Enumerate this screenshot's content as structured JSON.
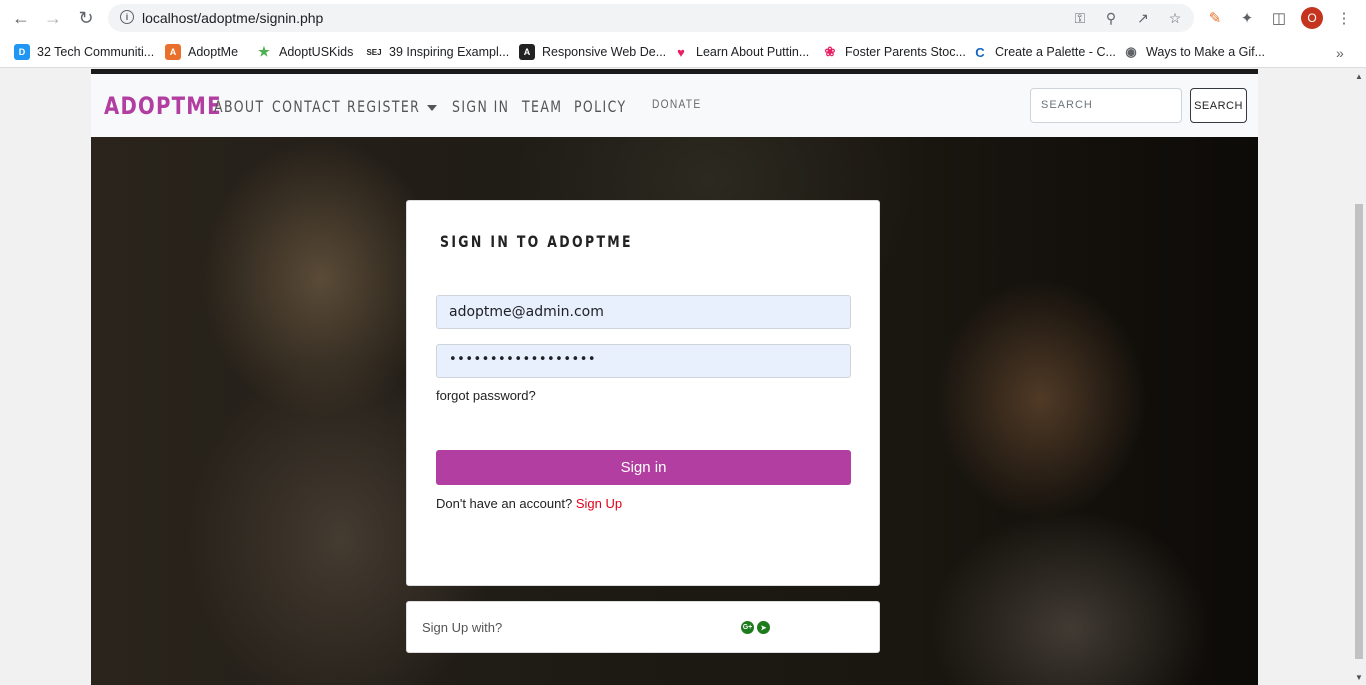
{
  "browser": {
    "url": "localhost/adoptme/signin.php",
    "avatar_letter": "O",
    "bookmarks": [
      {
        "label": "32 Tech Communiti...",
        "icon": "doc-icon",
        "color": "#2196f3"
      },
      {
        "label": "AdoptMe",
        "icon": "adoptme-icon",
        "color": "#e8702a"
      },
      {
        "label": "AdoptUSKids",
        "icon": "person-icon",
        "color": "#4caf50"
      },
      {
        "label": "39 Inspiring Exampl...",
        "icon": "sej-icon",
        "color": "#222222"
      },
      {
        "label": "Responsive Web De...",
        "icon": "responsive-icon",
        "color": "#222222"
      },
      {
        "label": "Learn About Puttin...",
        "icon": "heart-icon",
        "color": "#e91e63"
      },
      {
        "label": "Foster Parents Stoc...",
        "icon": "swirl-icon",
        "color": "#e91e63"
      },
      {
        "label": "Create a Palette - C...",
        "icon": "palette-icon",
        "color": "#1565c0"
      },
      {
        "label": "Ways to Make a Gif...",
        "icon": "globe-icon",
        "color": "#5f6368"
      }
    ]
  },
  "navbar": {
    "brand": "ADOPTME",
    "links": [
      "ABOUT",
      "CONTACT",
      "REGISTER",
      "SIGN IN",
      "TEAM",
      "POLICY"
    ],
    "donate": "DONATE",
    "search_placeholder": "SEARCH",
    "search_button": "SEARCH"
  },
  "signin": {
    "title": "SIGN IN TO ADOPTME",
    "email": "adoptme@admin.com",
    "password_mask": "••••••••••••••••••",
    "forgot": "forgot password?",
    "button": "Sign in",
    "no_account": "Don't have an account?",
    "signup": "Sign Up"
  },
  "social": {
    "label": "Sign Up with?",
    "google": "G+",
    "telegram": "➤"
  },
  "colors": {
    "accent": "#b13ea0",
    "signup_link": "#e0001b"
  }
}
